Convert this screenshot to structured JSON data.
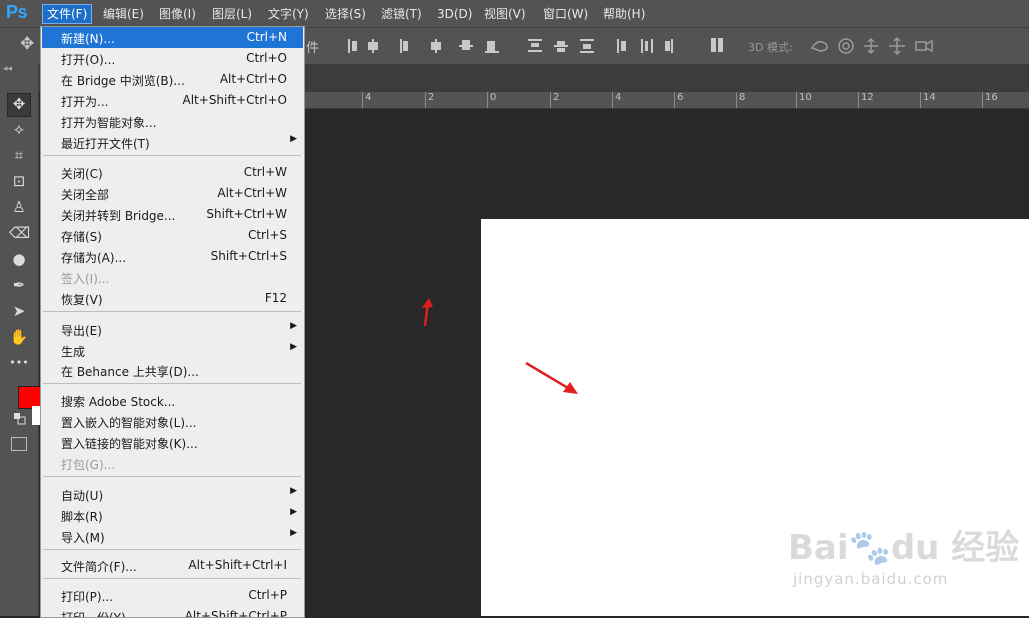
{
  "app": {
    "logo": "Ps"
  },
  "menubar": {
    "items": [
      {
        "label": "文件(F)"
      },
      {
        "label": "编辑(E)"
      },
      {
        "label": "图像(I)"
      },
      {
        "label": "图层(L)"
      },
      {
        "label": "文字(Y)"
      },
      {
        "label": "选择(S)"
      },
      {
        "label": "滤镜(T)"
      },
      {
        "label": "3D(D)"
      },
      {
        "label": "视图(V)"
      },
      {
        "label": "窗口(W)"
      },
      {
        "label": "帮助(H)"
      }
    ]
  },
  "options": {
    "partial_text": "件",
    "mode3d": "3D 模式:"
  },
  "file_menu": {
    "items": [
      {
        "label": "新建(N)...",
        "shortcut": "Ctrl+N",
        "highlighted": true
      },
      {
        "label": "打开(O)...",
        "shortcut": "Ctrl+O"
      },
      {
        "label": "在 Bridge 中浏览(B)...",
        "shortcut": "Alt+Ctrl+O"
      },
      {
        "label": "打开为...",
        "shortcut": "Alt+Shift+Ctrl+O"
      },
      {
        "label": "打开为智能对象...",
        "shortcut": ""
      },
      {
        "label": "最近打开文件(T)",
        "shortcut": "",
        "submenu": true
      },
      {
        "label": "关闭(C)",
        "shortcut": "Ctrl+W"
      },
      {
        "label": "关闭全部",
        "shortcut": "Alt+Ctrl+W"
      },
      {
        "label": "关闭并转到 Bridge...",
        "shortcut": "Shift+Ctrl+W"
      },
      {
        "label": "存储(S)",
        "shortcut": "Ctrl+S"
      },
      {
        "label": "存储为(A)...",
        "shortcut": "Shift+Ctrl+S"
      },
      {
        "label": "签入(I)...",
        "shortcut": "",
        "disabled": true
      },
      {
        "label": "恢复(V)",
        "shortcut": "F12"
      },
      {
        "label": "导出(E)",
        "shortcut": "",
        "submenu": true
      },
      {
        "label": "生成",
        "shortcut": "",
        "submenu": true
      },
      {
        "label": "在 Behance 上共享(D)...",
        "shortcut": ""
      },
      {
        "label": "搜索 Adobe Stock...",
        "shortcut": ""
      },
      {
        "label": "置入嵌入的智能对象(L)...",
        "shortcut": ""
      },
      {
        "label": "置入链接的智能对象(K)...",
        "shortcut": ""
      },
      {
        "label": "打包(G)...",
        "shortcut": "",
        "disabled": true
      },
      {
        "label": "自动(U)",
        "shortcut": "",
        "submenu": true
      },
      {
        "label": "脚本(R)",
        "shortcut": "",
        "submenu": true
      },
      {
        "label": "导入(M)",
        "shortcut": "",
        "submenu": true
      },
      {
        "label": "文件简介(F)...",
        "shortcut": "Alt+Shift+Ctrl+I"
      },
      {
        "label": "打印(P)...",
        "shortcut": "Ctrl+P"
      },
      {
        "label": "打印一份(Y)",
        "shortcut": "Alt+Shift+Ctrl+P"
      }
    ],
    "submenu_arrow": "▶"
  },
  "ruler": {
    "ticks": [
      "4",
      "2",
      "0",
      "2",
      "4",
      "6",
      "8",
      "10",
      "12",
      "14",
      "16"
    ]
  },
  "colors": {
    "foreground": "#ff0000",
    "background": "#ffffff",
    "highlight": "#1f75d6",
    "annotation_arrow": "#e02020"
  },
  "watermark": {
    "logo": "Bai🐾du 经验",
    "url": "jingyan.baidu.com"
  },
  "icons": {
    "move_tool": "✥",
    "lasso_tool": "⟡",
    "crop_tool": "⌗",
    "frame_tool": "⊡",
    "stamp_tool": "♙",
    "eraser_tool": "⌫",
    "drop_tool": "●",
    "pen_tool": "✒",
    "select_tool": "➤",
    "hand_tool": "✋",
    "more_tools": "•••"
  }
}
